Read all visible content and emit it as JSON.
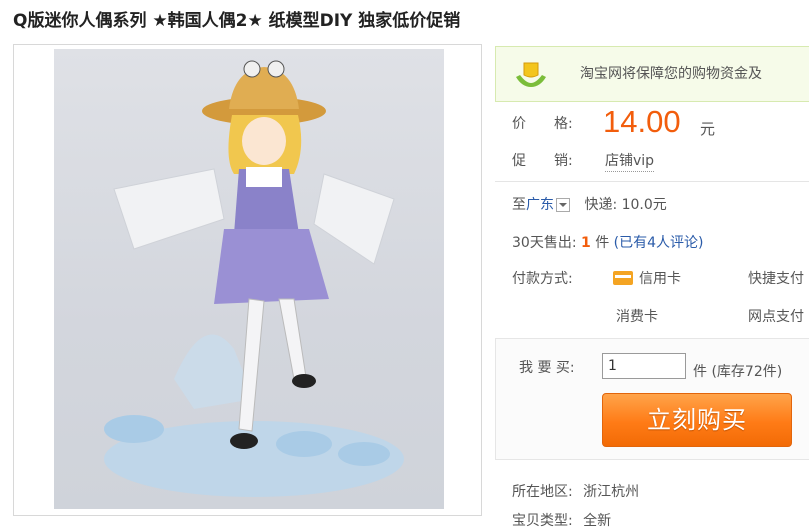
{
  "title": "Q版迷你人偶系列 ★韩国人偶2★ 纸模型DIY 独家低价促销",
  "guarantee_text": "淘宝网将保障您的购物资金及",
  "price": {
    "label": "价　　格:",
    "value": "14.00",
    "unit": "元"
  },
  "promo": {
    "label": "促　　销:",
    "value": "店铺vip"
  },
  "shipping": {
    "to": "至",
    "region": "广东",
    "method": "快递: 10.0元"
  },
  "sales": {
    "label": "30天售出:",
    "count": "1",
    "unit": "件",
    "reviews": "(已有4人评论)"
  },
  "payment": {
    "label": "付款方式:",
    "methods": [
      "信用卡",
      "快捷支付",
      "消费卡",
      "网点支付"
    ]
  },
  "buy": {
    "label": "我 要 买:",
    "quantity": "1",
    "stock": "件 (库存72件)",
    "button": "立刻购买"
  },
  "location": {
    "label": "所在地区:",
    "value": "浙江杭州"
  },
  "item_type": {
    "label": "宝贝类型:",
    "value": "全新"
  },
  "colors": {
    "price": "#f25d0c",
    "button": "#ff7b16",
    "link": "#2a5ba9"
  }
}
